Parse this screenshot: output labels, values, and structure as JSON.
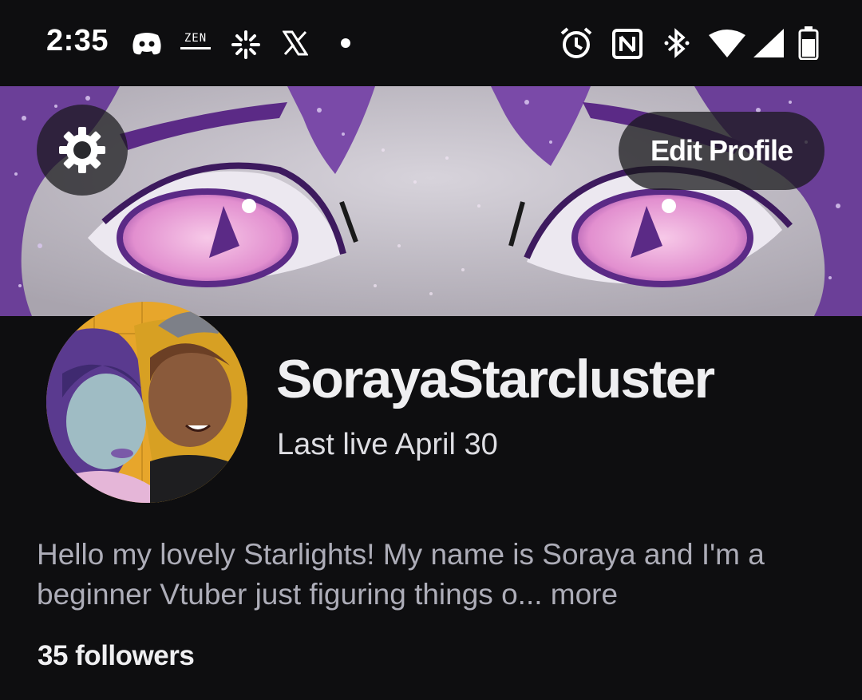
{
  "status_bar": {
    "time": "2:35",
    "zen_badge": "ZEN",
    "icons": [
      "discord-icon",
      "zen-app-icon",
      "spark-icon",
      "x-icon",
      "dot-icon",
      "alarm-icon",
      "nfc-icon",
      "bluetooth-icon",
      "wifi-icon",
      "signal-icon",
      "battery-icon"
    ]
  },
  "header": {
    "settings_icon": "gear-icon",
    "edit_profile_label": "Edit Profile"
  },
  "profile": {
    "username": "SorayaStarcluster",
    "last_live": "Last live April 30",
    "bio": "Hello my lovely Starlights! My name is Soraya and I'm a beginner Vtuber just figuring things o...",
    "bio_more": " more",
    "followers": "35 followers"
  },
  "colors": {
    "background": "#0e0e10",
    "banner_purple": "#6a3a9a",
    "text_primary": "#efeff1",
    "text_secondary": "#adadb8"
  }
}
